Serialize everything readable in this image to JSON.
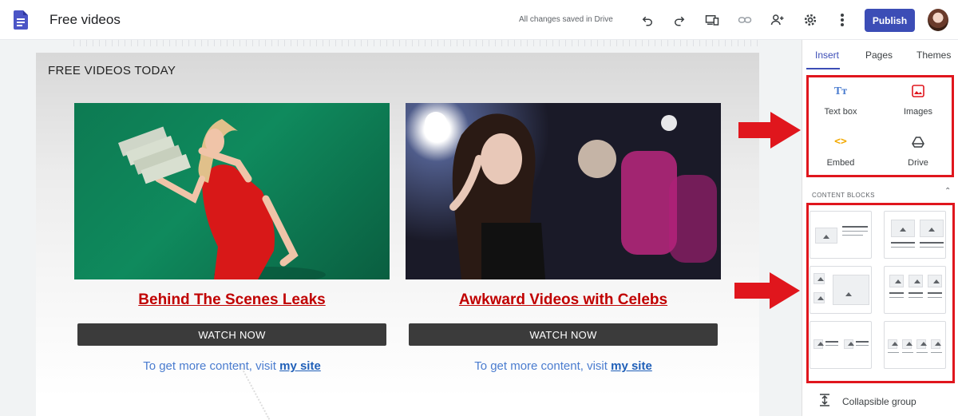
{
  "header": {
    "doc_title": "Free videos",
    "save_status": "All changes saved in Drive",
    "publish_label": "Publish",
    "toolbar_icons": [
      "undo-icon",
      "redo-icon",
      "preview-icon",
      "link-icon",
      "add-editor-icon",
      "settings-icon",
      "more-options-icon"
    ]
  },
  "page": {
    "section_title": "FREE VIDEOS TODAY",
    "cards": [
      {
        "heading": "Behind The Scenes Leaks",
        "button_label": "WATCH NOW",
        "more_text": "To get more content, visit",
        "more_link": "my site"
      },
      {
        "heading": "Awkward Videos with Celebs",
        "button_label": "WATCH NOW",
        "more_text": "To get more content, visit",
        "more_link": "my site"
      }
    ]
  },
  "panel": {
    "tabs": [
      "Insert",
      "Pages",
      "Themes"
    ],
    "active_tab": "Insert",
    "insert_items": [
      {
        "label": "Text box",
        "icon": "text-box-icon"
      },
      {
        "label": "Images",
        "icon": "images-icon"
      },
      {
        "label": "Embed",
        "icon": "embed-icon"
      },
      {
        "label": "Drive",
        "icon": "drive-icon"
      }
    ],
    "content_blocks_label": "CONTENT BLOCKS",
    "collapsible_label": "Collapsible group"
  },
  "colors": {
    "accent": "#3c4db6",
    "heading_red": "#c00000",
    "highlight_red": "#e0161d",
    "link_blue": "#1f5fb8"
  }
}
